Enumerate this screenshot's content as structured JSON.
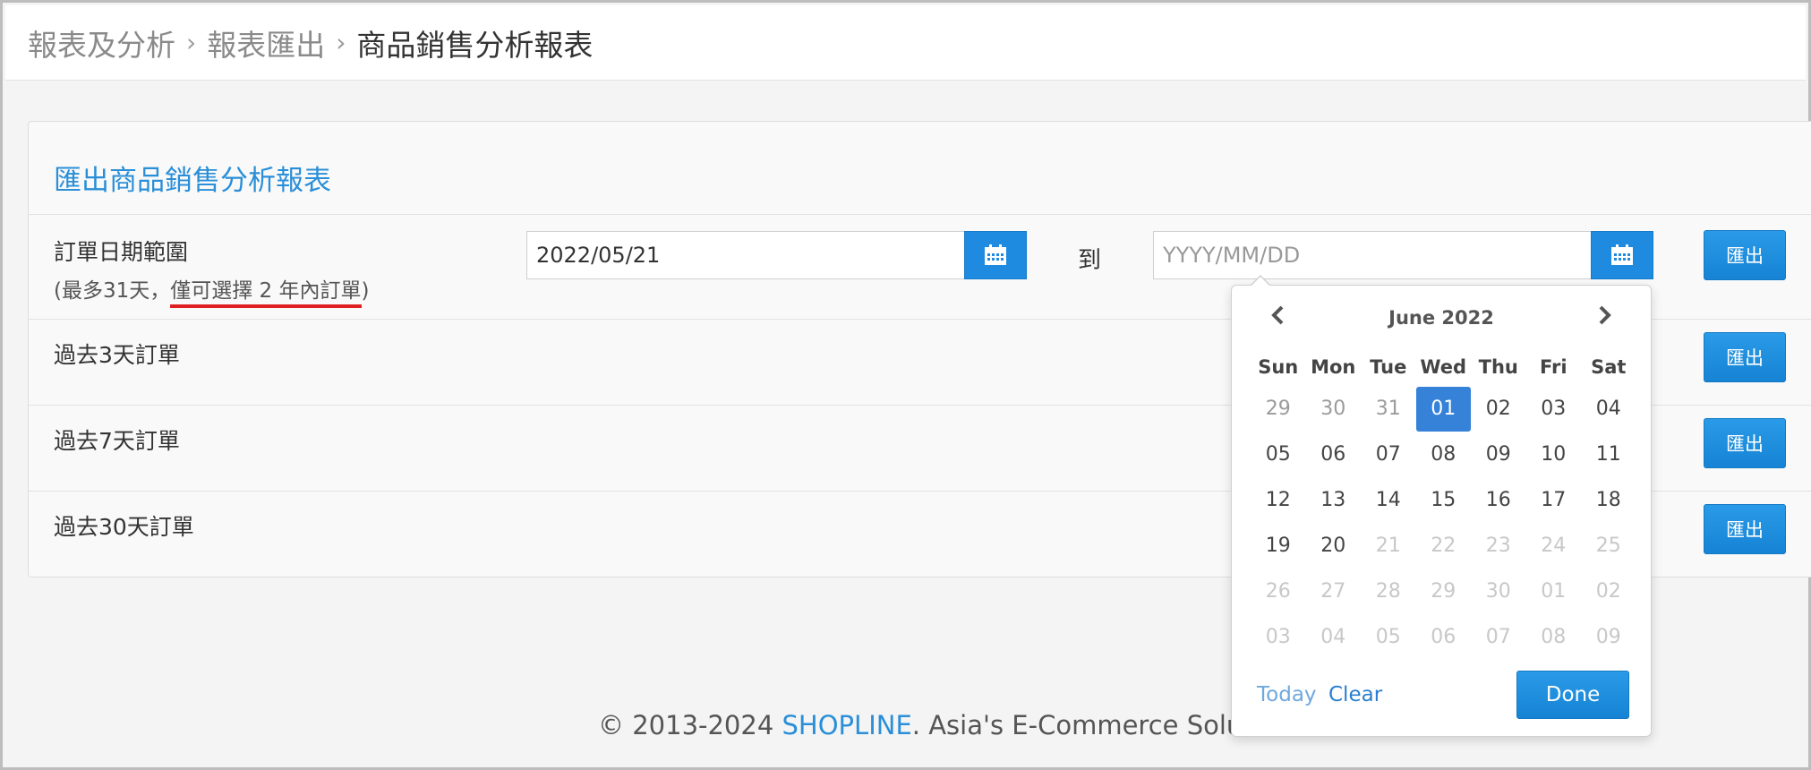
{
  "breadcrumb": {
    "items": [
      "報表及分析",
      "報表匯出"
    ],
    "current": "商品銷售分析報表",
    "separator": "›"
  },
  "card": {
    "title": "匯出商品銷售分析報表",
    "date_range": {
      "label": "訂單日期範圍",
      "note_prefix": "(最多31天，",
      "note_highlight": "僅可選擇 2 年內訂單",
      "note_suffix": ")",
      "start_value": "2022/05/21",
      "end_placeholder": "YYYY/MM/DD",
      "to_label": "到",
      "export_label": "匯出"
    },
    "rows": [
      {
        "label": "過去3天訂單",
        "export_label": "匯出"
      },
      {
        "label": "過去7天訂單",
        "export_label": "匯出"
      },
      {
        "label": "過去30天訂單",
        "export_label": "匯出"
      }
    ]
  },
  "datepicker": {
    "month_title": "June 2022",
    "weekdays": [
      "Sun",
      "Mon",
      "Tue",
      "Wed",
      "Thu",
      "Fri",
      "Sat"
    ],
    "weeks": [
      [
        [
          "29",
          "old"
        ],
        [
          "30",
          "old"
        ],
        [
          "31",
          "old"
        ],
        [
          "01",
          "active"
        ],
        [
          "02",
          ""
        ],
        [
          "03",
          ""
        ],
        [
          "04",
          ""
        ]
      ],
      [
        [
          "05",
          ""
        ],
        [
          "06",
          ""
        ],
        [
          "07",
          ""
        ],
        [
          "08",
          ""
        ],
        [
          "09",
          ""
        ],
        [
          "10",
          ""
        ],
        [
          "11",
          ""
        ]
      ],
      [
        [
          "12",
          ""
        ],
        [
          "13",
          ""
        ],
        [
          "14",
          ""
        ],
        [
          "15",
          ""
        ],
        [
          "16",
          ""
        ],
        [
          "17",
          ""
        ],
        [
          "18",
          ""
        ]
      ],
      [
        [
          "19",
          ""
        ],
        [
          "20",
          ""
        ],
        [
          "21",
          "dis"
        ],
        [
          "22",
          "dis"
        ],
        [
          "23",
          "dis"
        ],
        [
          "24",
          "dis"
        ],
        [
          "25",
          "dis"
        ]
      ],
      [
        [
          "26",
          "dis"
        ],
        [
          "27",
          "dis"
        ],
        [
          "28",
          "dis"
        ],
        [
          "29",
          "dis"
        ],
        [
          "30",
          "dis"
        ],
        [
          "01",
          "dis"
        ],
        [
          "02",
          "dis"
        ]
      ],
      [
        [
          "03",
          "dis"
        ],
        [
          "04",
          "dis"
        ],
        [
          "05",
          "dis"
        ],
        [
          "06",
          "dis"
        ],
        [
          "07",
          "dis"
        ],
        [
          "08",
          "dis"
        ],
        [
          "09",
          "dis"
        ]
      ]
    ],
    "today_label": "Today",
    "clear_label": "Clear",
    "done_label": "Done"
  },
  "footer": {
    "prefix": "© 2013-2024 ",
    "brand": "SHOPLINE",
    "suffix": ". Asia's E-Commerce Solution."
  },
  "colors": {
    "accent": "#1e8be0",
    "title_blue": "#2a8fd8",
    "highlight_underline": "#e02020"
  }
}
